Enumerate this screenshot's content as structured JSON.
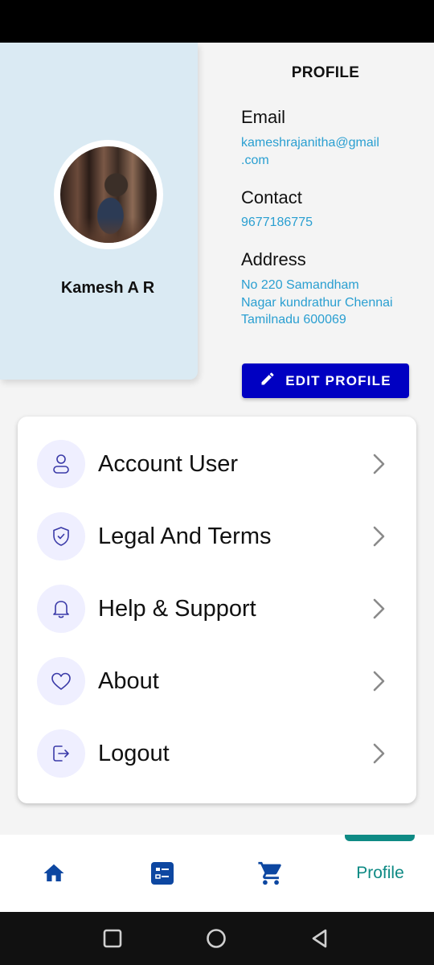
{
  "profile": {
    "user_name": "Kamesh A R",
    "page_title": "PROFILE",
    "email_label": "Email",
    "email_value": "kameshrajanitha@gmail\n.com",
    "contact_label": "Contact",
    "contact_value": "9677186775",
    "address_label": "Address",
    "address_value": "No 220 Samandham\nNagar kundrathur  Chennai\nTamilnadu  600069",
    "edit_button_label": "EDIT PROFILE"
  },
  "menu": {
    "items": [
      {
        "label": "Account User",
        "icon": "user-icon"
      },
      {
        "label": "Legal And Terms",
        "icon": "shield-icon"
      },
      {
        "label": "Help & Support",
        "icon": "bell-icon"
      },
      {
        "label": "About",
        "icon": "heart-icon"
      },
      {
        "label": "Logout",
        "icon": "logout-icon"
      }
    ]
  },
  "bottom_nav": {
    "items": [
      {
        "name": "home",
        "icon": "home-icon"
      },
      {
        "name": "list",
        "icon": "list-icon"
      },
      {
        "name": "cart",
        "icon": "cart-icon"
      },
      {
        "name": "profile",
        "label": "Profile"
      }
    ],
    "active": "profile"
  },
  "colors": {
    "accent_blue": "#0000c2",
    "link_blue": "#2a9fd1",
    "active_teal": "#0e8a84",
    "nav_icon_blue": "#0d47a1",
    "profile_card_bg": "#daeaf3"
  }
}
